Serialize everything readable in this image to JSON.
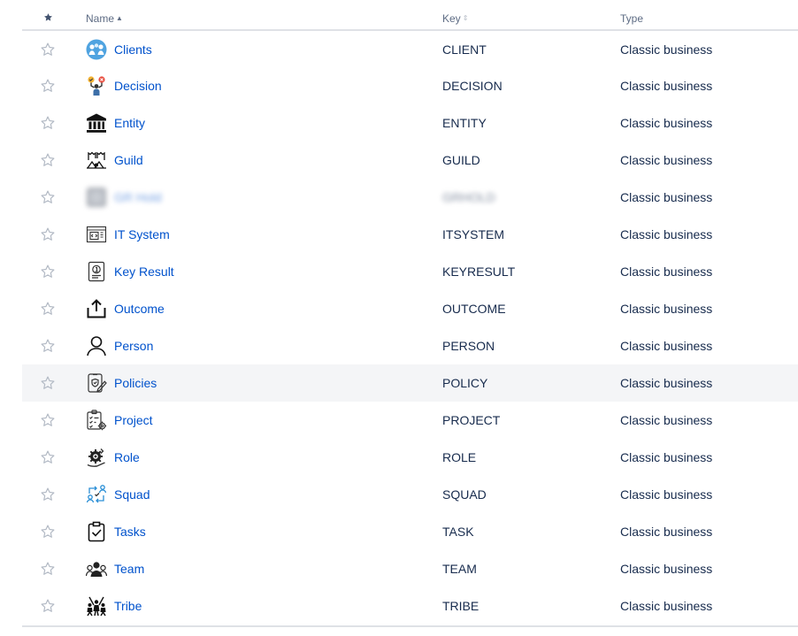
{
  "table": {
    "headers": {
      "star_icon": "star-icon",
      "name": "Name",
      "key": "Key",
      "type": "Type"
    },
    "rows": [
      {
        "name": "Clients",
        "key": "CLIENT",
        "type": "Classic business",
        "icon": "clients-icon"
      },
      {
        "name": "Decision",
        "key": "DECISION",
        "type": "Classic business",
        "icon": "decision-icon"
      },
      {
        "name": "Entity",
        "key": "ENTITY",
        "type": "Classic business",
        "icon": "entity-icon"
      },
      {
        "name": "Guild",
        "key": "GUILD",
        "type": "Classic business",
        "icon": "guild-icon"
      },
      {
        "name": "GR Hold",
        "key": "GRHOLD",
        "type": "Classic business",
        "icon": "blurred-icon",
        "blurred": true
      },
      {
        "name": "IT System",
        "key": "ITSYSTEM",
        "type": "Classic business",
        "icon": "it-system-icon"
      },
      {
        "name": "Key Result",
        "key": "KEYRESULT",
        "type": "Classic business",
        "icon": "key-result-icon"
      },
      {
        "name": "Outcome",
        "key": "OUTCOME",
        "type": "Classic business",
        "icon": "outcome-icon"
      },
      {
        "name": "Person",
        "key": "PERSON",
        "type": "Classic business",
        "icon": "person-icon"
      },
      {
        "name": "Policies",
        "key": "POLICY",
        "type": "Classic business",
        "icon": "policies-icon",
        "hovered": true
      },
      {
        "name": "Project",
        "key": "PROJECT",
        "type": "Classic business",
        "icon": "project-icon"
      },
      {
        "name": "Role",
        "key": "ROLE",
        "type": "Classic business",
        "icon": "role-icon"
      },
      {
        "name": "Squad",
        "key": "SQUAD",
        "type": "Classic business",
        "icon": "squad-icon"
      },
      {
        "name": "Tasks",
        "key": "TASK",
        "type": "Classic business",
        "icon": "tasks-icon"
      },
      {
        "name": "Team",
        "key": "TEAM",
        "type": "Classic business",
        "icon": "team-icon"
      },
      {
        "name": "Tribe",
        "key": "TRIBE",
        "type": "Classic business",
        "icon": "tribe-icon"
      }
    ]
  },
  "colors": {
    "link": "#0052cc",
    "text": "#172b4d",
    "header_text": "#5e6c84",
    "border": "#dfe1e6",
    "hover_row": "#f4f5f7"
  }
}
